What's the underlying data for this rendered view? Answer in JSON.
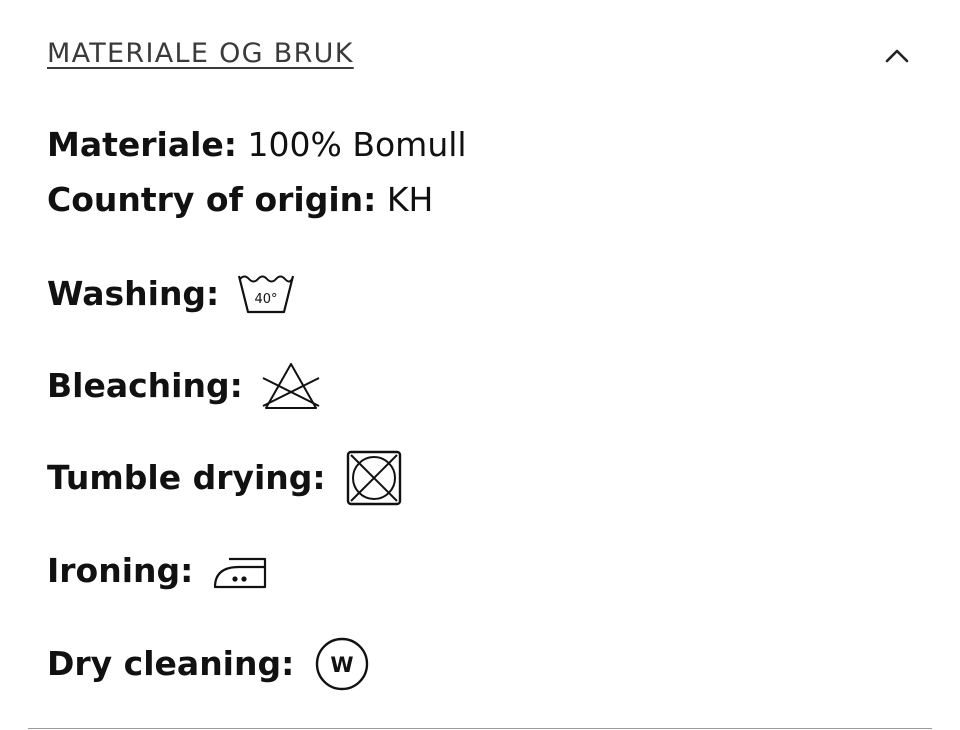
{
  "accordion": {
    "title": "MATERIALE OG BRUK",
    "toggle_icon": "chevron-up-icon"
  },
  "info": {
    "material_label": "Materiale:",
    "material_value": "100% Bomull",
    "origin_label": "Country of origin:",
    "origin_value": "KH"
  },
  "care": {
    "washing": {
      "label": "Washing:",
      "icon": "wash-tub-40-icon",
      "temperature": "40°"
    },
    "bleaching": {
      "label": "Bleaching:",
      "icon": "no-bleach-icon"
    },
    "tumble_drying": {
      "label": "Tumble drying:",
      "icon": "no-tumble-dry-icon"
    },
    "ironing": {
      "label": "Ironing:",
      "icon": "iron-two-dots-icon"
    },
    "dry_cleaning": {
      "label": "Dry cleaning:",
      "icon": "wet-clean-icon",
      "letter": "W"
    }
  }
}
